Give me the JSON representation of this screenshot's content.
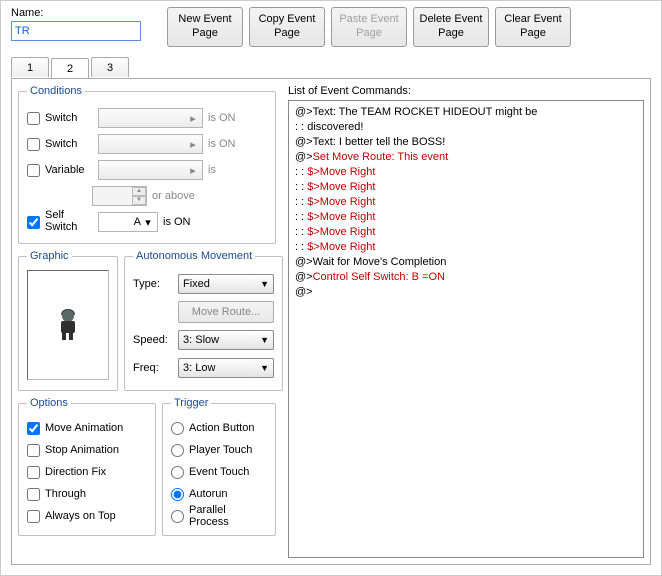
{
  "name_field": {
    "label": "Name:",
    "value": "TR"
  },
  "buttons": {
    "new": "New\nEvent Page",
    "copy": "Copy\nEvent Page",
    "paste": "Paste\nEvent Page",
    "delete": "Delete\nEvent Page",
    "clear": "Clear\nEvent Page"
  },
  "tabs": [
    "1",
    "2",
    "3"
  ],
  "active_tab": "2",
  "conditions": {
    "legend": "Conditions",
    "switch1": {
      "label": "Switch",
      "checked": false,
      "suffix": "is ON"
    },
    "switch2": {
      "label": "Switch",
      "checked": false,
      "suffix": "is ON"
    },
    "variable": {
      "label": "Variable",
      "checked": false,
      "suffix": "is",
      "suffix2": "or above"
    },
    "self_switch": {
      "label": "Self\nSwitch",
      "checked": true,
      "value": "A",
      "suffix": "is ON"
    }
  },
  "graphic": {
    "legend": "Graphic"
  },
  "autonomous": {
    "legend": "Autonomous Movement",
    "type_label": "Type:",
    "type_value": "Fixed",
    "route_label": "Move Route...",
    "speed_label": "Speed:",
    "speed_value": "3: Slow",
    "freq_label": "Freq:",
    "freq_value": "3: Low"
  },
  "options": {
    "legend": "Options",
    "items": [
      {
        "label": "Move Animation",
        "checked": true
      },
      {
        "label": "Stop Animation",
        "checked": false
      },
      {
        "label": "Direction Fix",
        "checked": false
      },
      {
        "label": "Through",
        "checked": false
      },
      {
        "label": "Always on Top",
        "checked": false
      }
    ]
  },
  "trigger": {
    "legend": "Trigger",
    "items": [
      {
        "label": "Action Button",
        "selected": false
      },
      {
        "label": "Player Touch",
        "selected": false
      },
      {
        "label": "Event Touch",
        "selected": false
      },
      {
        "label": "Autorun",
        "selected": true
      },
      {
        "label": "Parallel Process",
        "selected": false
      }
    ]
  },
  "commands_label": "List of Event Commands:",
  "commands": [
    {
      "t": "@>Text: The TEAM ROCKET HIDEOUT might be",
      "c": ""
    },
    {
      "t": " :          : discovered!",
      "c": ""
    },
    {
      "t": "@>Text:  I better tell the BOSS!",
      "c": ""
    },
    {
      "t": "@>",
      "c": "",
      "red": "Set Move Route: This event"
    },
    {
      "t": " :                             : ",
      "c": "",
      "red": "$>Move Right"
    },
    {
      "t": " :                             : ",
      "c": "",
      "red": "$>Move Right"
    },
    {
      "t": " :                             : ",
      "c": "",
      "red": "$>Move Right"
    },
    {
      "t": " :                             : ",
      "c": "",
      "red": "$>Move Right"
    },
    {
      "t": " :                             : ",
      "c": "",
      "red": "$>Move Right"
    },
    {
      "t": " :                             : ",
      "c": "",
      "red": "$>Move Right"
    },
    {
      "t": "@>Wait for Move's Completion",
      "c": ""
    },
    {
      "t": "@>",
      "c": "",
      "red": "Control Self Switch: B =ON"
    },
    {
      "t": "@>",
      "c": ""
    }
  ]
}
